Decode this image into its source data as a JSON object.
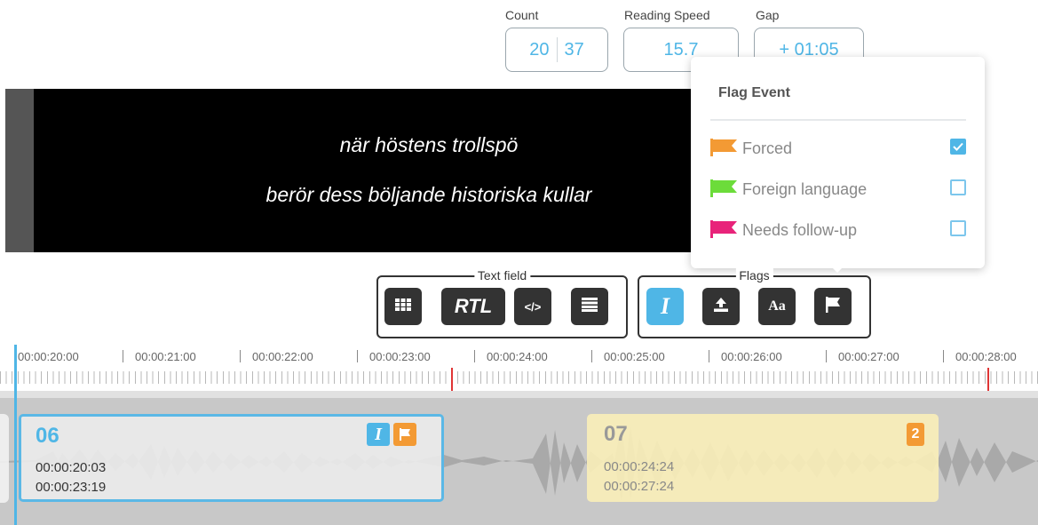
{
  "stats": {
    "count_label": "Count",
    "count_current": "20",
    "count_total": "37",
    "reading_speed_label": "Reading Speed",
    "reading_speed_value": "15.7",
    "gap_label": "Gap",
    "gap_value": "+ 01:05"
  },
  "preview": {
    "line1": "när höstens trollspö",
    "line2": "berör dess böljande historiska kullar"
  },
  "flag_popup": {
    "title": "Flag Event",
    "items": [
      {
        "label": "Forced",
        "color": "#f39a34",
        "checked": true
      },
      {
        "label": "Foreign language",
        "color": "#6cdc3a",
        "checked": false
      },
      {
        "label": "Needs follow-up",
        "color": "#e8237a",
        "checked": false
      }
    ]
  },
  "toolbar": {
    "text_field_legend": "Text field",
    "flags_legend": "Flags",
    "text_field_buttons": [
      {
        "icon": "grid-icon"
      },
      {
        "icon": "rtl-icon",
        "label": "RTL"
      },
      {
        "icon": "code-icon",
        "label": "</>"
      },
      {
        "icon": "align-justify-icon"
      }
    ],
    "flags_buttons": [
      {
        "icon": "italic-icon",
        "label": "I",
        "active": true
      },
      {
        "icon": "upload-icon"
      },
      {
        "icon": "font-case-icon",
        "label": "Aa"
      },
      {
        "icon": "flag-icon"
      }
    ]
  },
  "timeline": {
    "ticks": [
      "00:00:20:00",
      "00:00:21:00",
      "00:00:22:00",
      "00:00:23:00",
      "00:00:24:00",
      "00:00:25:00",
      "00:00:26:00",
      "00:00:27:00",
      "00:00:28:00"
    ]
  },
  "events": [
    {
      "number": "06",
      "start": "00:00:20:03",
      "end": "00:00:23:19",
      "flags": [
        "italic",
        "forced"
      ]
    },
    {
      "number": "07",
      "start": "00:00:24:24",
      "end": "00:00:27:24",
      "badge": "2"
    }
  ],
  "colors": {
    "accent": "#4fb6e6",
    "forced_flag": "#f39a34",
    "foreign_flag": "#6cdc3a",
    "followup_flag": "#e8237a",
    "marker": "#e03535"
  }
}
